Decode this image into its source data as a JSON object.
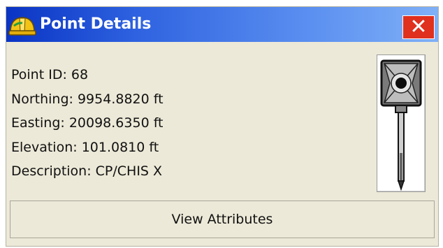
{
  "window": {
    "title": "Point Details",
    "close_label": "✕"
  },
  "icons": {
    "app": "hardhat-icon",
    "instrument": "prism-pole-icon",
    "close": "close-icon"
  },
  "details": [
    "Point ID: 68",
    "Northing: 9954.8820 ft",
    "Easting: 20098.6350 ft",
    "Elevation: 101.0810 ft",
    "Description: CP/CHIS X"
  ],
  "buttons": {
    "view_attributes": "View Attributes"
  },
  "colors": {
    "titlebar_start": "#0a34c4",
    "titlebar_end": "#7fb0f7",
    "close_red": "#e0301e",
    "dialog_bg": "#ece9d8"
  }
}
